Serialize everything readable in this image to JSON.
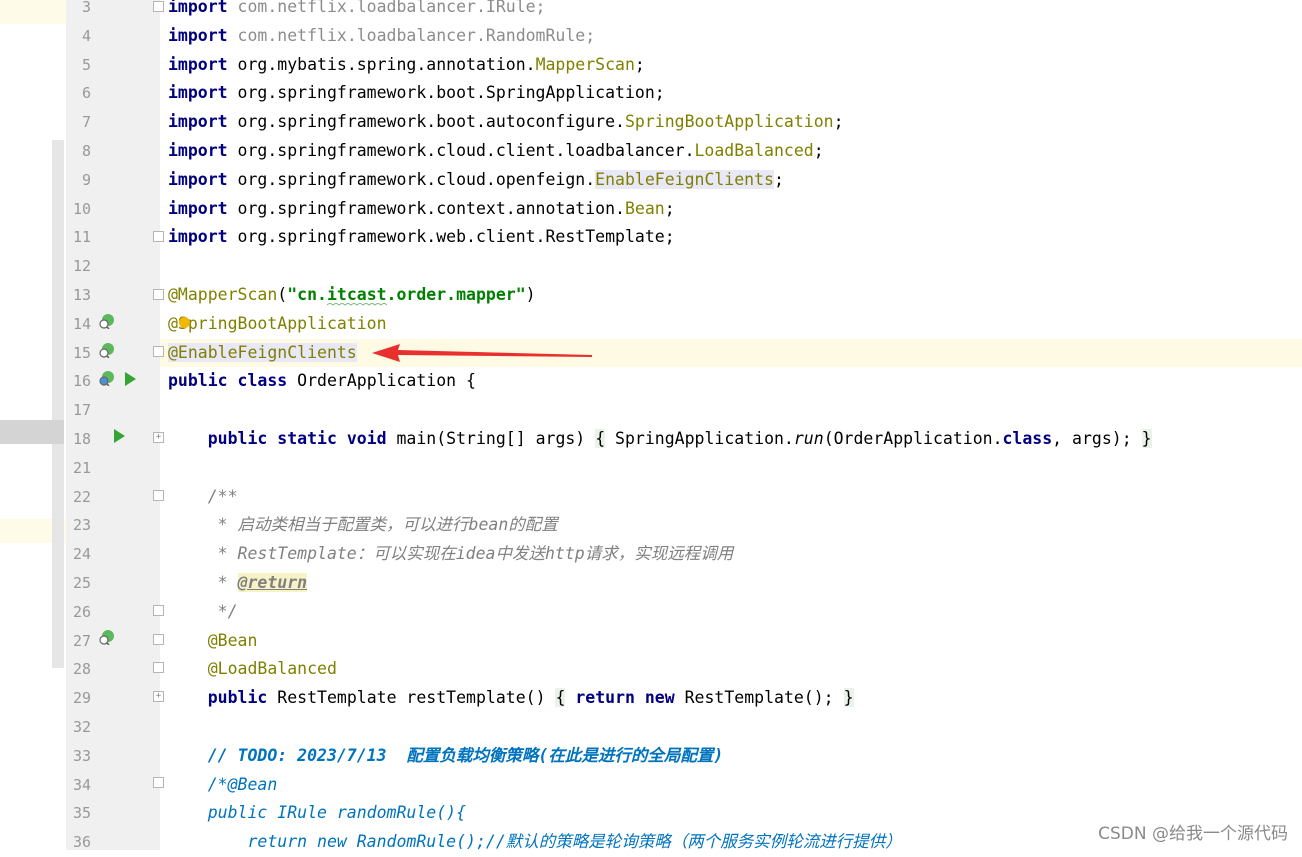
{
  "editor": {
    "lines": [
      {
        "num": "3",
        "tokens": [
          {
            "t": "import",
            "c": "kw"
          },
          {
            "t": " com.netflix.loadbalancer.IRule;",
            "c": "gray"
          }
        ]
      },
      {
        "num": "4",
        "tokens": [
          {
            "t": "import",
            "c": "kw"
          },
          {
            "t": " com.netflix.loadbalancer.RandomRule;",
            "c": "gray"
          }
        ]
      },
      {
        "num": "5",
        "tokens": [
          {
            "t": "import",
            "c": "kw"
          },
          {
            "t": " org.mybatis.spring.annotation."
          },
          {
            "t": "MapperScan",
            "c": "ann"
          },
          {
            "t": ";"
          }
        ]
      },
      {
        "num": "6",
        "tokens": [
          {
            "t": "import",
            "c": "kw"
          },
          {
            "t": " org.springframework.boot.SpringApplication;"
          }
        ]
      },
      {
        "num": "7",
        "tokens": [
          {
            "t": "import",
            "c": "kw"
          },
          {
            "t": " org.springframework.boot.autoconfigure."
          },
          {
            "t": "SpringBootApplication",
            "c": "ann"
          },
          {
            "t": ";"
          }
        ]
      },
      {
        "num": "8",
        "tokens": [
          {
            "t": "import",
            "c": "kw"
          },
          {
            "t": " org.springframework.cloud.client.loadbalancer."
          },
          {
            "t": "LoadBalanced",
            "c": "ann"
          },
          {
            "t": ";"
          }
        ]
      },
      {
        "num": "9",
        "tokens": [
          {
            "t": "import",
            "c": "kw"
          },
          {
            "t": " org.springframework.cloud.openfeign."
          },
          {
            "t": "EnableFeignClients",
            "c": "ann hl-usage"
          },
          {
            "t": ";"
          }
        ]
      },
      {
        "num": "10",
        "tokens": [
          {
            "t": "import",
            "c": "kw"
          },
          {
            "t": " org.springframework.context.annotation."
          },
          {
            "t": "Bean",
            "c": "ann"
          },
          {
            "t": ";"
          }
        ]
      },
      {
        "num": "11",
        "tokens": [
          {
            "t": "import",
            "c": "kw"
          },
          {
            "t": " org.springframework.web.client.RestTemplate;"
          }
        ]
      },
      {
        "num": "12",
        "tokens": []
      },
      {
        "num": "13",
        "tokens": [
          {
            "t": "@MapperScan",
            "c": "ann"
          },
          {
            "t": "("
          },
          {
            "t": "\"cn.itcast.order.mapper\"",
            "c": "str"
          },
          {
            "t": ")"
          }
        ]
      },
      {
        "num": "14",
        "tokens": [
          {
            "t": "@SpringBootApplication",
            "c": "ann"
          }
        ]
      },
      {
        "num": "15",
        "tokens": [
          {
            "t": "@EnableFeignClients",
            "c": "ann hl-usage"
          }
        ]
      },
      {
        "num": "16",
        "tokens": [
          {
            "t": "public class",
            "c": "kw"
          },
          {
            "t": " OrderApplication {"
          }
        ]
      },
      {
        "num": "17",
        "tokens": []
      },
      {
        "num": "18",
        "tokens": [
          {
            "t": "    "
          },
          {
            "t": "public static void",
            "c": "kw"
          },
          {
            "t": " main(String[] args) "
          },
          {
            "t": "{",
            "c": "brace"
          },
          {
            "t": " SpringApplication."
          },
          {
            "t": "run",
            "c": "ital"
          },
          {
            "t": "(OrderApplication."
          },
          {
            "t": "class",
            "c": "kw"
          },
          {
            "t": ", args); "
          },
          {
            "t": "}",
            "c": "brace"
          }
        ]
      },
      {
        "num": "21",
        "tokens": []
      },
      {
        "num": "22",
        "tokens": [
          {
            "t": "    /**",
            "c": "cmt"
          }
        ]
      },
      {
        "num": "23",
        "tokens": [
          {
            "t": "     * 启动类相当于配置类，可以进行bean的配置",
            "c": "cmt"
          }
        ]
      },
      {
        "num": "24",
        "tokens": [
          {
            "t": "     * RestTemplate：可以实现在idea中发送http请求，实现远程调用",
            "c": "cmt"
          }
        ]
      },
      {
        "num": "25",
        "tokens": [
          {
            "t": "     * ",
            "c": "cmt"
          },
          {
            "t": "@return",
            "c": "tag"
          }
        ]
      },
      {
        "num": "26",
        "tokens": [
          {
            "t": "     */",
            "c": "cmt"
          }
        ]
      },
      {
        "num": "27",
        "tokens": [
          {
            "t": "    "
          },
          {
            "t": "@Bean",
            "c": "ann"
          }
        ]
      },
      {
        "num": "28",
        "tokens": [
          {
            "t": "    "
          },
          {
            "t": "@LoadBalanced",
            "c": "ann"
          }
        ]
      },
      {
        "num": "29",
        "tokens": [
          {
            "t": "    "
          },
          {
            "t": "public",
            "c": "kw"
          },
          {
            "t": " RestTemplate restTemplate() "
          },
          {
            "t": "{",
            "c": "brace"
          },
          {
            "t": " "
          },
          {
            "t": "return new",
            "c": "kw"
          },
          {
            "t": " RestTemplate(); "
          },
          {
            "t": "}",
            "c": "brace"
          }
        ]
      },
      {
        "num": "32",
        "tokens": []
      },
      {
        "num": "33",
        "tokens": [
          {
            "t": "    // TODO: 2023/7/13  配置负载均衡策略(在此是进行的全局配置)",
            "c": "todo"
          }
        ]
      },
      {
        "num": "34",
        "tokens": [
          {
            "t": "    /*@Bean",
            "c": "todo2"
          }
        ]
      },
      {
        "num": "35",
        "tokens": [
          {
            "t": "    public IRule randomRule(){",
            "c": "todo2"
          }
        ]
      },
      {
        "num": "36",
        "tokens": [
          {
            "t": "        return new RandomRule();//默认的策略是轮询策略（两个服务实例轮流进行提供）",
            "c": "todo2"
          }
        ]
      }
    ]
  },
  "watermark": "CSDN @给我一个源代码",
  "colors": {
    "keyword": "#000080",
    "annotation": "#808000",
    "string": "#008000",
    "comment": "#808080",
    "todo": "#0073bf",
    "arrow": "#e8302e"
  }
}
